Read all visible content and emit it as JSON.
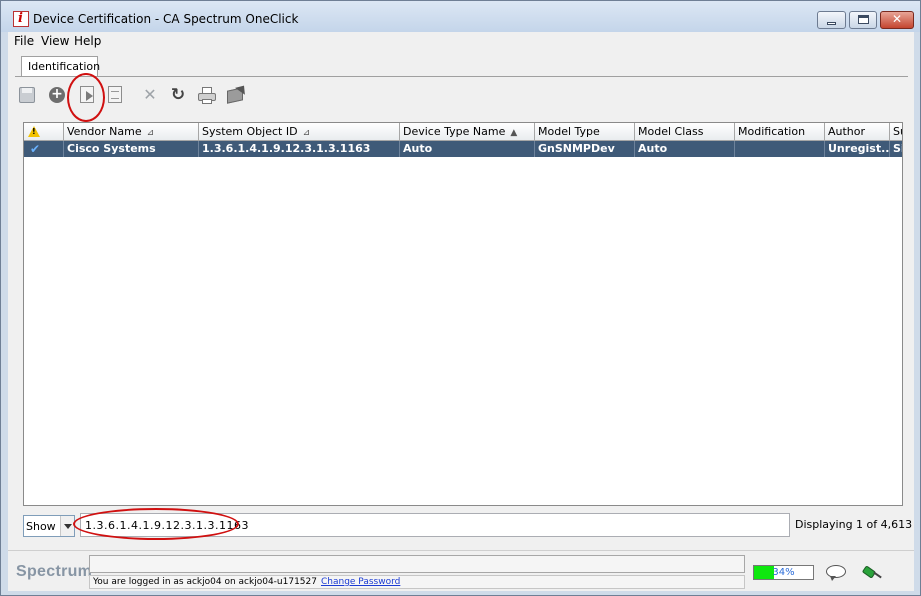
{
  "window": {
    "title": "Device Certification - CA Spectrum OneClick",
    "icon": "spectrum-app-icon"
  },
  "menu": [
    "File",
    "View",
    "Help"
  ],
  "tabs": [
    {
      "label": "Identification",
      "active": true
    }
  ],
  "toolbar": {
    "buttons": [
      {
        "name": "save",
        "icon": "save-icon",
        "enabled": false
      },
      {
        "name": "add",
        "icon": "add-circle-icon",
        "enabled": true
      },
      {
        "name": "edit",
        "icon": "edit-document-icon",
        "enabled": true,
        "highlighted": true
      },
      {
        "name": "copy",
        "icon": "copy-document-icon",
        "enabled": true
      },
      {
        "name": "delete",
        "icon": "delete-icon",
        "enabled": false
      },
      {
        "name": "refresh",
        "icon": "refresh-icon",
        "enabled": true
      },
      {
        "name": "print",
        "icon": "print-icon",
        "enabled": true
      },
      {
        "name": "export",
        "icon": "export-icon",
        "enabled": true
      }
    ]
  },
  "table": {
    "columns": [
      "",
      "Vendor Name",
      "System Object ID",
      "Device Type Name",
      "Model Type",
      "Model Class",
      "Modification",
      "Author",
      "Su"
    ],
    "sorted_columns": [
      "Vendor Name",
      "System Object ID",
      "Device Type Name"
    ],
    "rows": [
      {
        "selected": true,
        "status": "check",
        "vendor": "Cisco Systems",
        "oid": "1.3.6.1.4.1.9.12.3.1.3.1163",
        "device_type": "Auto",
        "model_type": "GnSNMPDev",
        "model_class": "Auto",
        "modification": "",
        "author": "Unregist...",
        "su": "Si"
      }
    ]
  },
  "filter": {
    "show_label": "Show",
    "value": "1.3.6.1.4.1.9.12.3.1.3.1163",
    "count_text": "Displaying 1 of 4,613"
  },
  "status": {
    "brand": "Spectrum",
    "login_text": "You are logged in as ackjo04 on ackjo04-u171527",
    "change_password": "Change Password",
    "progress_percent": 34,
    "progress_label": "34%"
  },
  "colors": {
    "selection": "#3f5a78",
    "annotation": "#d01010",
    "progress": "#0ee80e"
  }
}
